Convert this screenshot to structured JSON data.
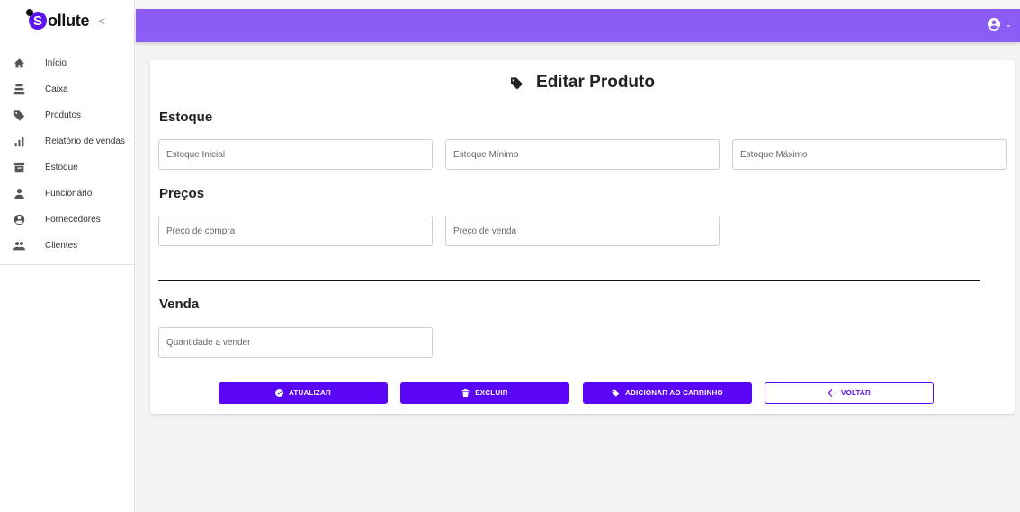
{
  "brand": {
    "logo_letter": "S",
    "name": "ollute",
    "collapse_glyph": "<"
  },
  "sidebar": {
    "items": [
      {
        "label": "Início",
        "icon": "home-icon"
      },
      {
        "label": "Caixa",
        "icon": "cash-register-icon"
      },
      {
        "label": "Produtos",
        "icon": "tag-icon"
      },
      {
        "label": "Relatório de vendas",
        "icon": "bar-chart-icon"
      },
      {
        "label": "Estoque",
        "icon": "archive-icon"
      },
      {
        "label": "Funcionário",
        "icon": "person-icon"
      },
      {
        "label": "Fornecedores",
        "icon": "handshake-icon"
      },
      {
        "label": "Clientes",
        "icon": "people-icon"
      }
    ]
  },
  "topbar": {
    "account_icon": "user-circle-icon",
    "account_chevron": "⌄"
  },
  "page": {
    "title": "Editar Produto",
    "title_icon": "tag-icon",
    "sections": {
      "estoque": {
        "title": "Estoque",
        "fields": {
          "inicial": {
            "placeholder": "Estoque Inicial",
            "value": ""
          },
          "minimo": {
            "placeholder": "Estoque Mínimo",
            "value": ""
          },
          "maximo": {
            "placeholder": "Estoque Máximo",
            "value": ""
          }
        }
      },
      "precos": {
        "title": "Preços",
        "fields": {
          "compra": {
            "placeholder": "Preço de compra",
            "value": ""
          },
          "venda": {
            "placeholder": "Preço de venda",
            "value": ""
          }
        }
      },
      "venda": {
        "title": "Venda",
        "fields": {
          "quantidade": {
            "placeholder": "Quantidade a vender",
            "value": ""
          }
        }
      }
    },
    "buttons": {
      "atualizar": {
        "label": "ATUALIZAR",
        "icon": "check-circle-icon"
      },
      "excluir": {
        "label": "EXCLUIR",
        "icon": "trash-icon"
      },
      "carrinho": {
        "label": "ADICIONAR AO CARRINHO",
        "icon": "tag-icon"
      },
      "voltar": {
        "label": "VOLTAR",
        "icon": "arrow-left-icon"
      }
    }
  },
  "colors": {
    "primary": "#5b06f6",
    "topbar": "#8b5cf6",
    "background": "#f4f4f5"
  }
}
